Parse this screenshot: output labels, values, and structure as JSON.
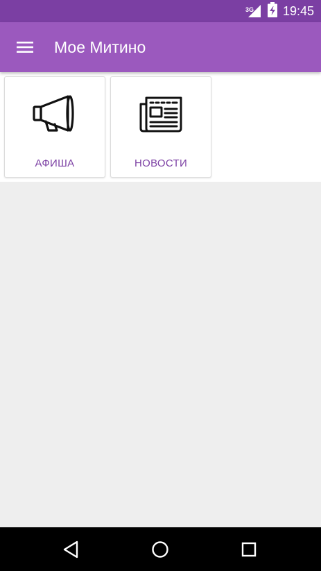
{
  "status_bar": {
    "network_label": "3G",
    "time": "19:45",
    "icons": [
      "signal-icon",
      "battery-charging-icon"
    ]
  },
  "app_bar": {
    "title": "Мое Митино",
    "menu_icon": "hamburger-menu-icon"
  },
  "tiles": [
    {
      "label": "АФИША",
      "icon": "megaphone-icon"
    },
    {
      "label": "НОВОСТИ",
      "icon": "newspaper-icon"
    }
  ],
  "nav_bar": {
    "icons": [
      "back-icon",
      "home-icon",
      "recents-icon"
    ]
  },
  "colors": {
    "status_bar": "#7b3fa3",
    "app_bar": "#9b59be",
    "accent_text": "#7b3fa3",
    "background": "#eeeeee",
    "tile_background": "#ffffff",
    "nav_bar": "#000000"
  }
}
